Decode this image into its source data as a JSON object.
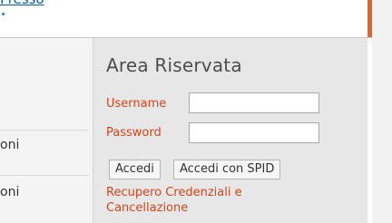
{
  "header": {
    "link_text": "Presso"
  },
  "menu": {
    "items": [
      {
        "label": "oni"
      },
      {
        "label": "oni"
      }
    ]
  },
  "login": {
    "title": "Area Riservata",
    "username_label": "Username",
    "password_label": "Password",
    "username_value": "",
    "password_value": "",
    "login_button": "Accedi",
    "spid_button": "Accedi con SPID",
    "recover_link": "Recupero Credenziali e Cancellazione"
  },
  "colors": {
    "accent": "#e4651e",
    "label": "#d4451b",
    "link": "#0b5aa2"
  }
}
